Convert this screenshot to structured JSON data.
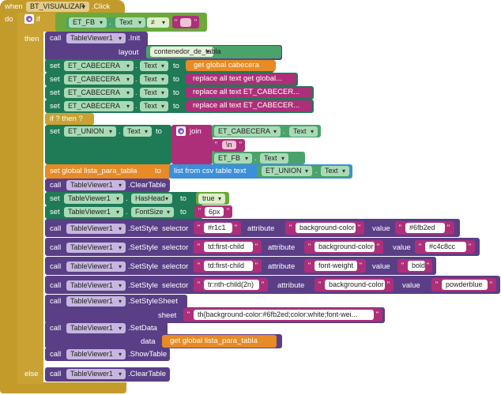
{
  "colors": {
    "control": "#c9a233",
    "component": "#5a3f87",
    "text": "#ad2f7a",
    "logic": "#6ca83c",
    "variable": "#e88a25",
    "list": "#3d8fd9",
    "event_gold": "#c39b2a"
  },
  "event": {
    "when": "when",
    "do": "do",
    "component": "BT_VISUALIZAR",
    "event_name": ".Click"
  },
  "if_block": {
    "if": "if",
    "then": "then",
    "else": "else"
  },
  "condition": {
    "component": "ET_FB",
    "property": "Text",
    "operator": "≠",
    "text": ""
  },
  "init": {
    "call": "call",
    "component": "TableViewer1",
    "method": ".Init",
    "layout_label": "layout",
    "layout_value": "contenedor_de_tabla"
  },
  "set_rows": [
    {
      "set": "set",
      "component": "ET_CABECERA",
      "property": "Text",
      "to": "to",
      "value": "get global cabecera"
    },
    {
      "set": "set",
      "component": "ET_CABECERA",
      "property": "Text",
      "to": "to",
      "value": "replace all text get global..."
    },
    {
      "set": "set",
      "component": "ET_CABECERA",
      "property": "Text",
      "to": "to",
      "value": "replace all text ET_CABECER..."
    },
    {
      "set": "set",
      "component": "ET_CABECERA",
      "property": "Text",
      "to": "to",
      "value": "replace all text ET_CABECER..."
    }
  ],
  "ternary": {
    "label": "if ? then ?"
  },
  "union": {
    "set": "set",
    "component": "ET_UNION",
    "property": "Text",
    "to": "to",
    "join": "join",
    "arg1_component": "ET_CABECERA",
    "arg1_property": "Text",
    "arg2_text": "\\n",
    "arg3_component": "ET_FB",
    "arg3_property": "Text"
  },
  "global_set": {
    "label": "set global lista_para_tabla",
    "to": "to",
    "csv": "list from csv table  text",
    "component": "ET_UNION",
    "property": "Text"
  },
  "clear_table": {
    "call": "call",
    "component": "TableViewer1",
    "method": ".ClearTable"
  },
  "has_head": {
    "set": "set",
    "component": "TableViewer1",
    "property": "HasHead",
    "to": "to",
    "value": "true"
  },
  "font_size": {
    "set": "set",
    "component": "TableViewer1",
    "property": "FontSize",
    "to": "to",
    "value": "6px"
  },
  "styles": [
    {
      "call": "call",
      "component": "TableViewer1",
      "method": ".SetStyle",
      "selector_label": "selector",
      "selector": "#r1c1",
      "attribute_label": "attribute",
      "attribute": "background-color",
      "value_label": "value",
      "value": "#6fb2ed"
    },
    {
      "call": "call",
      "component": "TableViewer1",
      "method": ".SetStyle",
      "selector_label": "selector",
      "selector": "td:first-child",
      "attribute_label": "attribute",
      "attribute": "background-color",
      "value_label": "value",
      "value": "#c4c8cc"
    },
    {
      "call": "call",
      "component": "TableViewer1",
      "method": ".SetStyle",
      "selector_label": "selector",
      "selector": "td:first-child",
      "attribute_label": "attribute",
      "attribute": "font-weight",
      "value_label": "value",
      "value": "bold"
    },
    {
      "call": "call",
      "component": "TableViewer1",
      "method": ".SetStyle",
      "selector_label": "selector",
      "selector": "tr:nth-child(2n)",
      "attribute_label": "attribute",
      "attribute": "background-color",
      "value_label": "value",
      "value": "powderblue"
    }
  ],
  "style_sheet": {
    "call": "call",
    "component": "TableViewer1",
    "method": ".SetStyleSheet",
    "sheet_label": "sheet",
    "sheet": "th{background-color:#6fb2ed;color:white;font-wei..."
  },
  "set_data": {
    "call": "call",
    "component": "TableViewer1",
    "method": ".SetData",
    "data_label": "data",
    "value": "get global lista_para_tabla"
  },
  "show_table": {
    "call": "call",
    "component": "TableViewer1",
    "method": ".ShowTable"
  },
  "else_clear": {
    "call": "call",
    "component": "TableViewer1",
    "method": ".ClearTable"
  }
}
